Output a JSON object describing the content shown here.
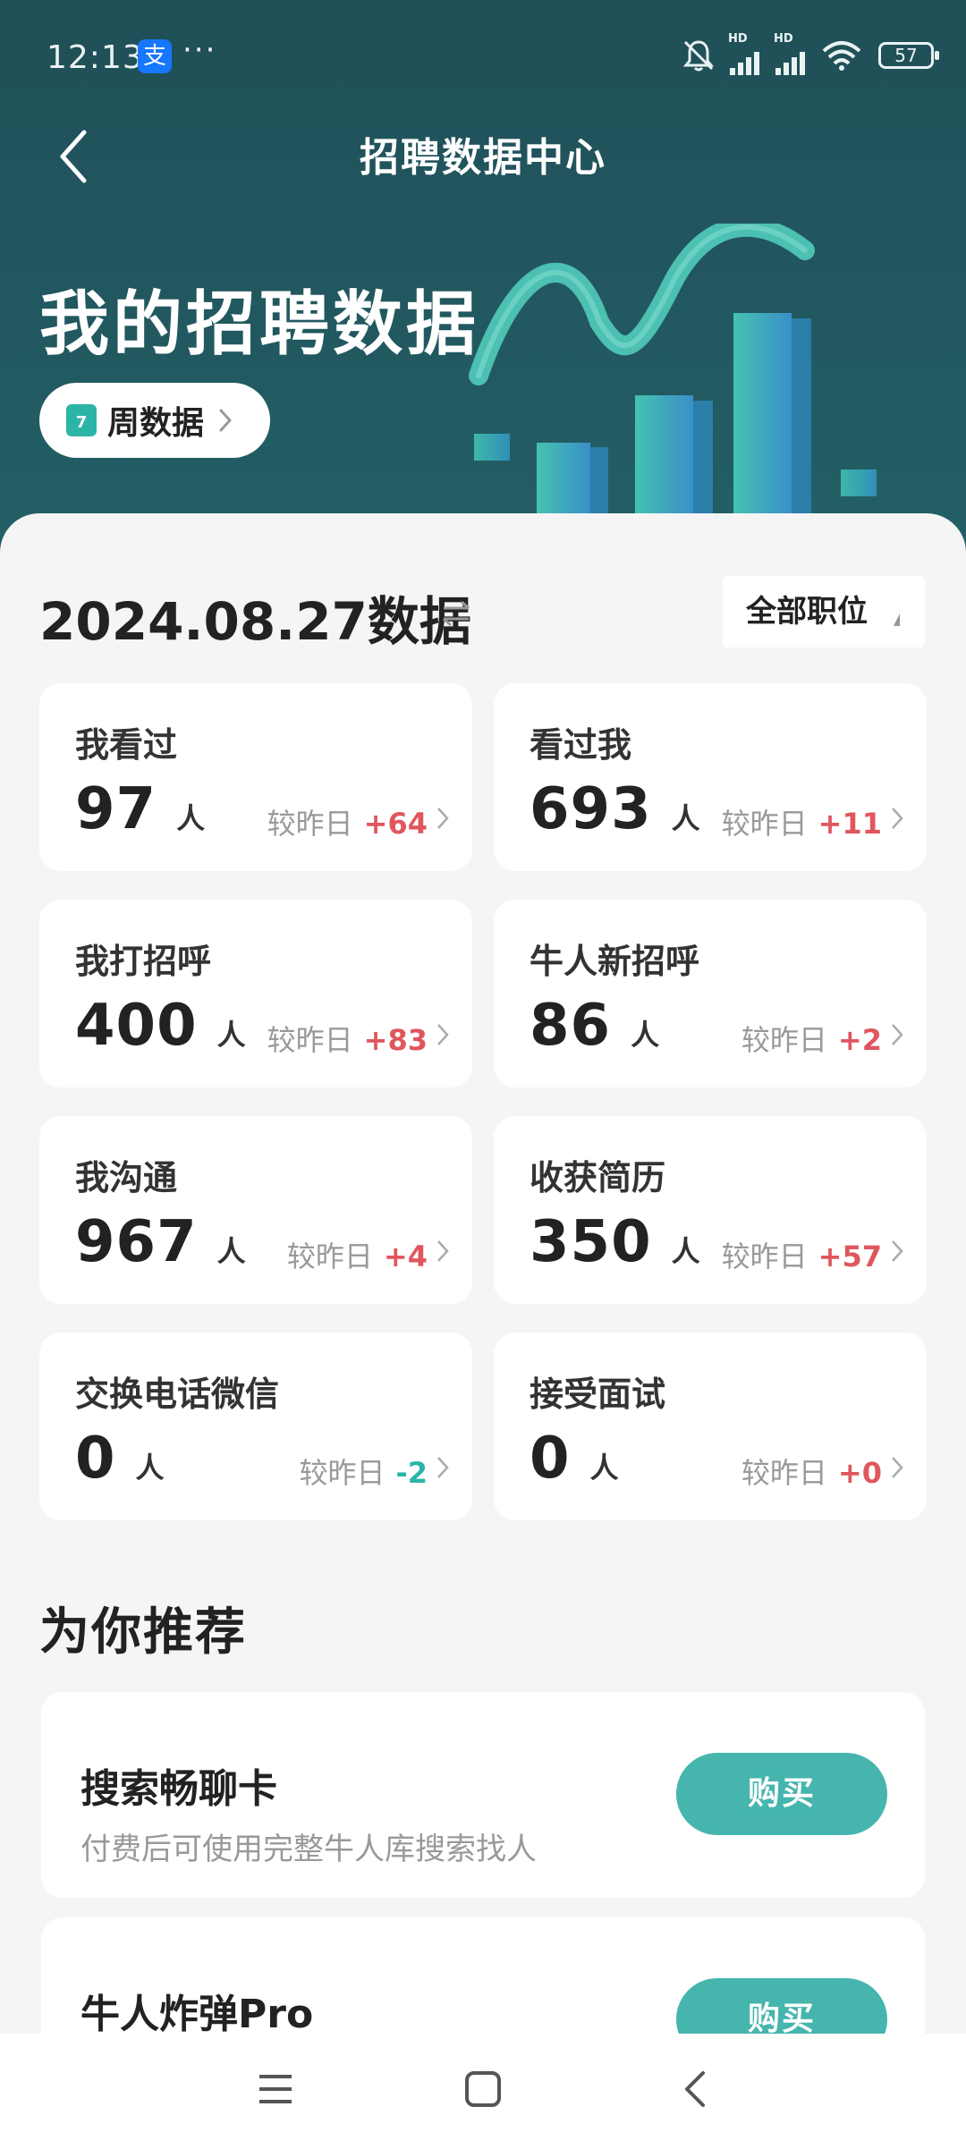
{
  "status_bar": {
    "time": "12:13",
    "alipay_glyph": "支",
    "dots": "···",
    "hd": "HD",
    "battery": "57"
  },
  "header": {
    "title": "招聘数据中心",
    "hero_title": "我的招聘数据",
    "week_calendar_day": "7",
    "week_button": "周数据"
  },
  "summary": {
    "date_title": "2024.08.27数据",
    "position_filter": "全部职位"
  },
  "stats": [
    {
      "title": "我看过",
      "value": "97",
      "unit": "人",
      "compare": "较昨日",
      "delta": "+64",
      "trend": "up"
    },
    {
      "title": "看过我",
      "value": "693",
      "unit": "人",
      "compare": "较昨日",
      "delta": "+11",
      "trend": "up"
    },
    {
      "title": "我打招呼",
      "value": "400",
      "unit": "人",
      "compare": "较昨日",
      "delta": "+83",
      "trend": "up"
    },
    {
      "title": "牛人新招呼",
      "value": "86",
      "unit": "人",
      "compare": "较昨日",
      "delta": "+2",
      "trend": "up"
    },
    {
      "title": "我沟通",
      "value": "967",
      "unit": "人",
      "compare": "较昨日",
      "delta": "+4",
      "trend": "up"
    },
    {
      "title": "收获简历",
      "value": "350",
      "unit": "人",
      "compare": "较昨日",
      "delta": "+57",
      "trend": "up"
    },
    {
      "title": "交换电话微信",
      "value": "0",
      "unit": "人",
      "compare": "较昨日",
      "delta": "-2",
      "trend": "down"
    },
    {
      "title": "接受面试",
      "value": "0",
      "unit": "人",
      "compare": "较昨日",
      "delta": "+0",
      "trend": "up"
    }
  ],
  "recommend": {
    "section_title": "为你推荐",
    "items": [
      {
        "title": "搜索畅聊卡",
        "desc": "付费后可使用完整牛人库搜索找人",
        "button": "购买"
      },
      {
        "title": "牛人炸弹Pro",
        "desc": "",
        "button": "购买"
      }
    ]
  },
  "colors": {
    "header_bg": "#22575f",
    "accent": "#45b5ad",
    "up": "#e0565e",
    "down": "#2bb5a7"
  }
}
